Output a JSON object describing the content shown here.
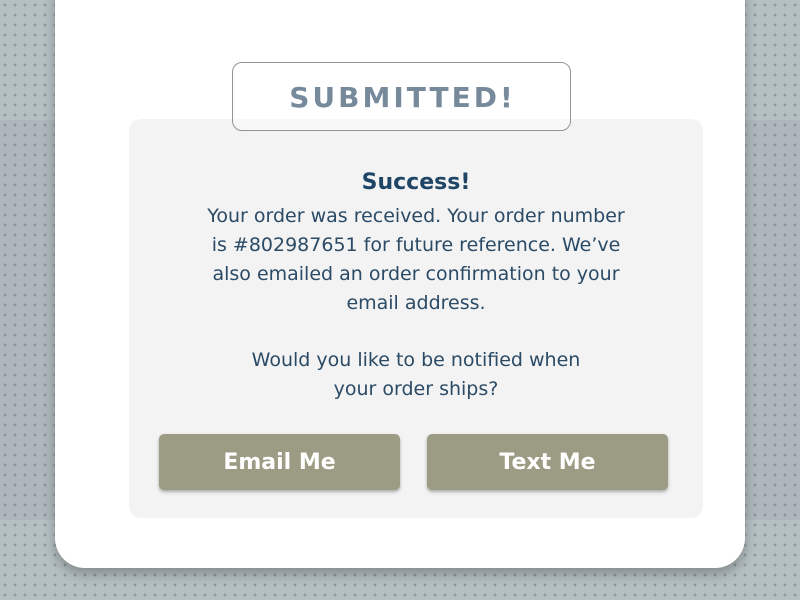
{
  "banner": {
    "text": "SUBMITTED!"
  },
  "dialog": {
    "title": "Success!",
    "message_lines": [
      "Your order was received. Your order number",
      "is #802987651 for future reference. We’ve",
      "also emailed an order confirmation to your",
      "email address."
    ],
    "question_lines": [
      "Would you like to be notified when",
      "your order ships?"
    ],
    "order_number": "#802987651"
  },
  "buttons": {
    "email_label": "Email Me",
    "text_label": "Text Me"
  },
  "colors": {
    "title": "#1f4566",
    "banner_text": "#778a9b",
    "button_bg": "#9c9c84",
    "panel_bg": "#f3f3f3",
    "page_pattern": "#b5c0c3"
  }
}
